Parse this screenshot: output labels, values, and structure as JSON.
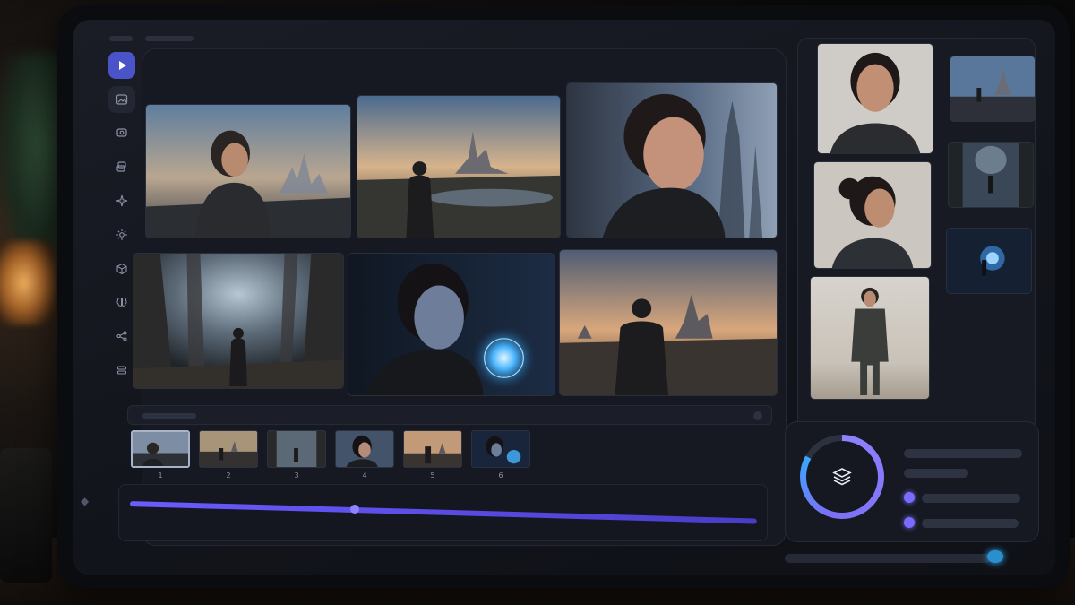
{
  "app": {
    "sidebar_icons": [
      "play-icon",
      "image-icon",
      "gallery-icon",
      "layers-icon",
      "sparkle-icon",
      "settings-icon",
      "cube-icon",
      "brain-icon",
      "share-icon",
      "stack-icon"
    ]
  },
  "filmstrip": {
    "frames": [
      {
        "num": "1"
      },
      {
        "num": "2"
      },
      {
        "num": "3"
      },
      {
        "num": "4"
      },
      {
        "num": "5"
      },
      {
        "num": "6"
      }
    ]
  },
  "widget": {
    "icon": "layers-stack-icon",
    "progress": 0.83
  },
  "colors": {
    "accent": "#6a5cff",
    "accent_light": "#8f82ff",
    "glow_blue": "#34b3ff"
  }
}
